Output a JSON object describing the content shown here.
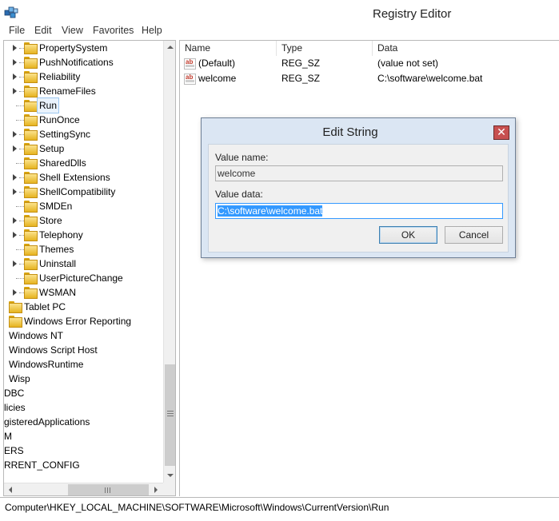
{
  "window": {
    "title": "Registry Editor",
    "icon": "registry-editor-icon"
  },
  "menu": [
    "File",
    "Edit",
    "View",
    "Favorites",
    "Help"
  ],
  "tree": {
    "items": [
      {
        "label": "PropertySystem",
        "expander": true,
        "folder": true
      },
      {
        "label": "PushNotifications",
        "expander": true,
        "folder": true
      },
      {
        "label": "Reliability",
        "expander": true,
        "folder": true
      },
      {
        "label": "RenameFiles",
        "expander": true,
        "folder": true
      },
      {
        "label": "Run",
        "expander": false,
        "folder": true,
        "selected": true
      },
      {
        "label": "RunOnce",
        "expander": false,
        "folder": true
      },
      {
        "label": "SettingSync",
        "expander": true,
        "folder": true
      },
      {
        "label": "Setup",
        "expander": true,
        "folder": true
      },
      {
        "label": "SharedDlls",
        "expander": false,
        "folder": true
      },
      {
        "label": "Shell Extensions",
        "expander": true,
        "folder": true
      },
      {
        "label": "ShellCompatibility",
        "expander": true,
        "folder": true
      },
      {
        "label": "SMDEn",
        "expander": false,
        "folder": true
      },
      {
        "label": "Store",
        "expander": true,
        "folder": true
      },
      {
        "label": "Telephony",
        "expander": true,
        "folder": true
      },
      {
        "label": "Themes",
        "expander": false,
        "folder": true
      },
      {
        "label": "Uninstall",
        "expander": true,
        "folder": true
      },
      {
        "label": "UserPictureChange",
        "expander": false,
        "folder": true
      },
      {
        "label": "WSMAN",
        "expander": true,
        "folder": true
      },
      {
        "label": "Tablet PC",
        "expander": false,
        "folder": true
      },
      {
        "label": "Windows Error Reporting",
        "expander": false,
        "folder": true
      },
      {
        "label": "Windows NT",
        "expander": false,
        "folder": false
      },
      {
        "label": "Windows Script Host",
        "expander": false,
        "folder": false
      },
      {
        "label": "WindowsRuntime",
        "expander": false,
        "folder": false
      },
      {
        "label": "Wisp",
        "expander": false,
        "folder": false
      },
      {
        "label": "DBC",
        "expander": false,
        "folder": false
      },
      {
        "label": "licies",
        "expander": false,
        "folder": false
      },
      {
        "label": "gisteredApplications",
        "expander": false,
        "folder": false
      },
      {
        "label": "M",
        "expander": false,
        "folder": false
      },
      {
        "label": "ERS",
        "expander": false,
        "folder": false
      },
      {
        "label": "RRENT_CONFIG",
        "expander": false,
        "folder": false
      }
    ]
  },
  "list": {
    "columns": [
      "Name",
      "Type",
      "Data"
    ],
    "rows": [
      {
        "name": "(Default)",
        "type": "REG_SZ",
        "data": "(value not set)",
        "icon": "string-value-icon"
      },
      {
        "name": "welcome",
        "type": "REG_SZ",
        "data": "C:\\software\\welcome.bat",
        "icon": "string-value-icon"
      }
    ]
  },
  "status": {
    "path": "Computer\\HKEY_LOCAL_MACHINE\\SOFTWARE\\Microsoft\\Windows\\CurrentVersion\\Run"
  },
  "dialog": {
    "title": "Edit String",
    "close": "✕",
    "value_name_label": "Value name:",
    "value_name": "welcome",
    "value_data_label": "Value data:",
    "value_data": "C:\\software\\welcome.bat",
    "ok_label": "OK",
    "cancel_label": "Cancel"
  },
  "scroll": {
    "hscroll_grip": "|||"
  }
}
